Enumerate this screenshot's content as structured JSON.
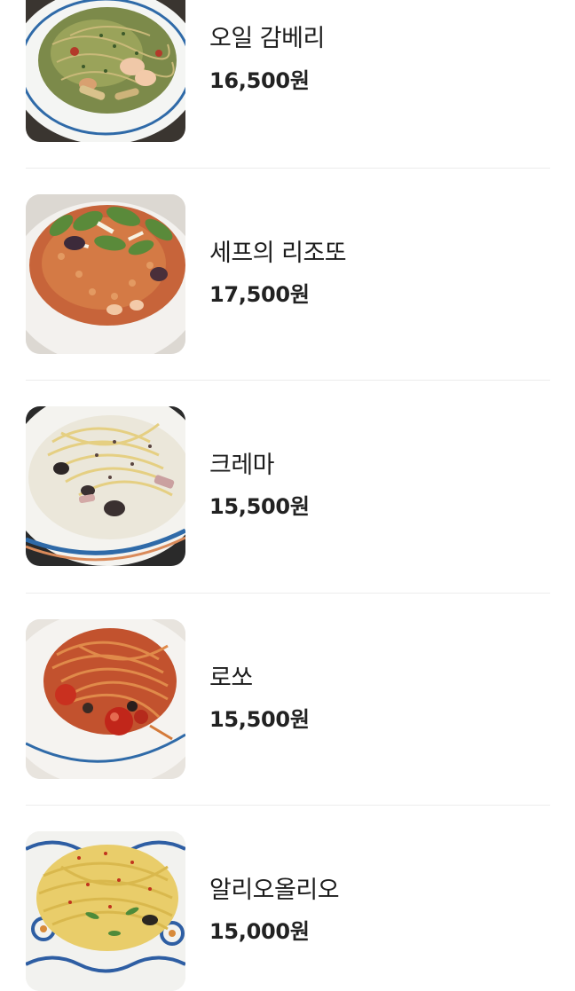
{
  "menu": {
    "items": [
      {
        "name": "오일 감베리",
        "price": "16,500원",
        "image": "oil-gamberi-pasta-photo"
      },
      {
        "name": "세프의 리조또",
        "price": "17,500원",
        "image": "chef-risotto-photo"
      },
      {
        "name": "크레마",
        "price": "15,500원",
        "image": "crema-pasta-photo"
      },
      {
        "name": "로쏘",
        "price": "15,500원",
        "image": "rosso-pasta-photo"
      },
      {
        "name": "알리오올리오",
        "price": "15,000원",
        "image": "aglio-olio-pasta-photo"
      }
    ]
  },
  "colors": {
    "background": "#ffffff",
    "text": "#1c1c1c",
    "divider": "#ececec"
  }
}
